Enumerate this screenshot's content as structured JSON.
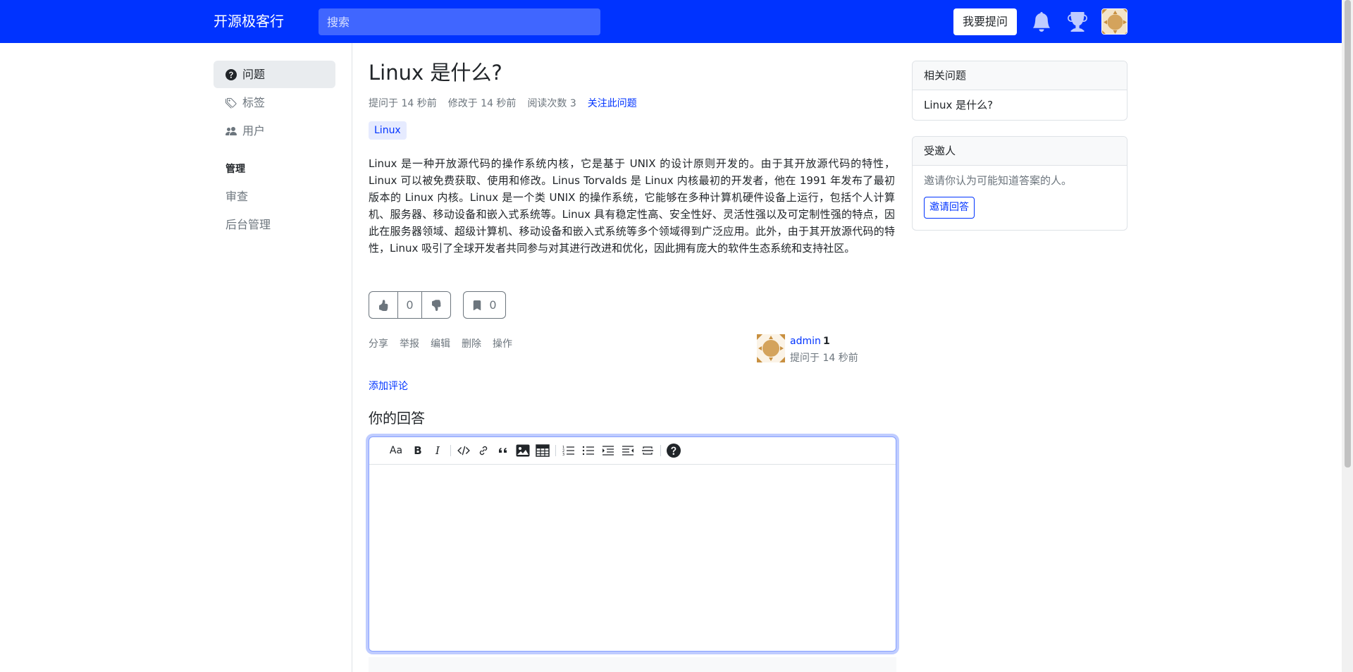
{
  "header": {
    "brand": "开源极客行",
    "search_placeholder": "搜索",
    "ask_button": "我要提问",
    "icons": [
      "bell-icon",
      "trophy-icon",
      "avatar"
    ],
    "brand_color": "#0033ff"
  },
  "sidebar": {
    "items": [
      {
        "label": "问题",
        "icon": "question-circle-icon",
        "active": true
      },
      {
        "label": "标签",
        "icon": "tags-icon",
        "active": false
      },
      {
        "label": "用户",
        "icon": "people-icon",
        "active": false
      }
    ],
    "section_title": "管理",
    "admin_items": [
      {
        "label": "审查"
      },
      {
        "label": "后台管理"
      }
    ]
  },
  "question": {
    "title": "Linux 是什么?",
    "asked": "提问于 14 秒前",
    "modified": "修改于 14 秒前",
    "views": "阅读次数 3",
    "follow": "关注此问题",
    "tag": "Linux",
    "body": "Linux 是一种开放源代码的操作系统内核，它是基于 UNIX 的设计原则开发的。由于其开放源代码的特性，Linux 可以被免费获取、使用和修改。Linus Torvalds 是 Linux 内核最初的开发者，他在 1991 年发布了最初版本的 Linux 内核。Linux 是一个类 UNIX 的操作系统，它能够在多种计算机硬件设备上运行，包括个人计算机、服务器、移动设备和嵌入式系统等。Linux 具有稳定性高、安全性好、灵活性强以及可定制性强的特点，因此在服务器领域、超级计算机、移动设备和嵌入式系统等多个领域得到广泛应用。此外，由于其开放源代码的特性，Linux 吸引了全球开发者共同参与对其进行改进和优化，因此拥有庞大的软件生态系统和支持社区。",
    "vote_count": "0",
    "bookmark_count": "0",
    "actions": [
      "分享",
      "举报",
      "编辑",
      "删除",
      "操作"
    ],
    "author": {
      "name": "admin",
      "reputation": "1",
      "time": "提问于 14 秒前"
    },
    "add_comment": "添加评论"
  },
  "answer": {
    "heading": "你的回答",
    "toolbar": [
      "heading-icon",
      "bold-icon",
      "italic-icon",
      "code-icon",
      "link-icon",
      "quote-icon",
      "image-icon",
      "table-icon",
      "ordered-list-icon",
      "unordered-list-icon",
      "indent-icon",
      "outdent-icon",
      "hr-icon",
      "help-icon"
    ],
    "toolbar_heading_label": "Aa",
    "toolbar_bold_label": "B",
    "toolbar_italic_label": "I"
  },
  "related": {
    "title": "相关问题",
    "items": [
      "Linux 是什么?"
    ]
  },
  "invite": {
    "title": "受邀人",
    "text": "邀请你认为可能知道答案的人。",
    "button": "邀请回答"
  }
}
